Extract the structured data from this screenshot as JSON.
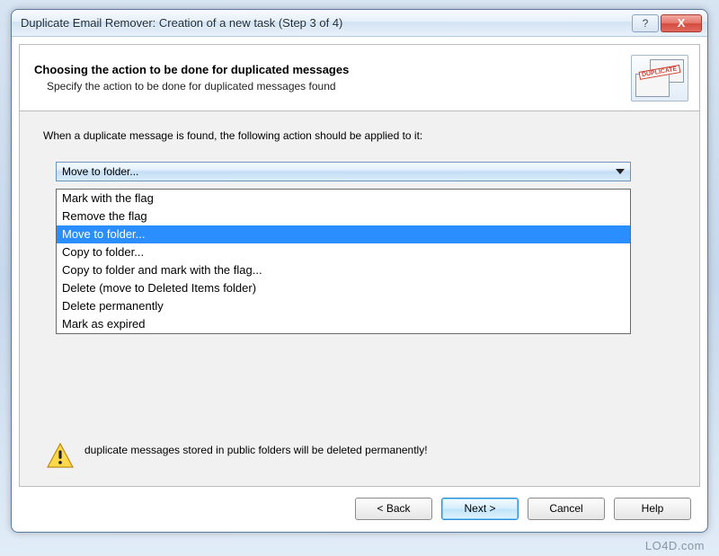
{
  "window": {
    "title": "Duplicate Email Remover: Creation of a new task (Step 3 of 4)"
  },
  "titlebar_buttons": {
    "help": "?",
    "close": "X"
  },
  "header": {
    "title": "Choosing the action to be done for duplicated messages",
    "subtitle": "Specify the action to be done for duplicated messages found",
    "icon_stamp": "DUPLICATE"
  },
  "body": {
    "instruction": "When a duplicate message is found, the following action should be applied to it:",
    "combo_selected": "Move to folder...",
    "options": [
      "Mark with the flag",
      "Remove the flag",
      "Move to folder...",
      "Copy to folder...",
      "Copy to folder and mark with the flag...",
      "Delete (move to Deleted Items folder)",
      "Delete permanently",
      "Mark as expired"
    ],
    "selected_index": 2,
    "caution": "duplicate messages stored in public folders will be deleted permanently!"
  },
  "buttons": {
    "back": "< Back",
    "next": "Next >",
    "cancel": "Cancel",
    "help": "Help"
  },
  "watermark": "LO4D.com"
}
